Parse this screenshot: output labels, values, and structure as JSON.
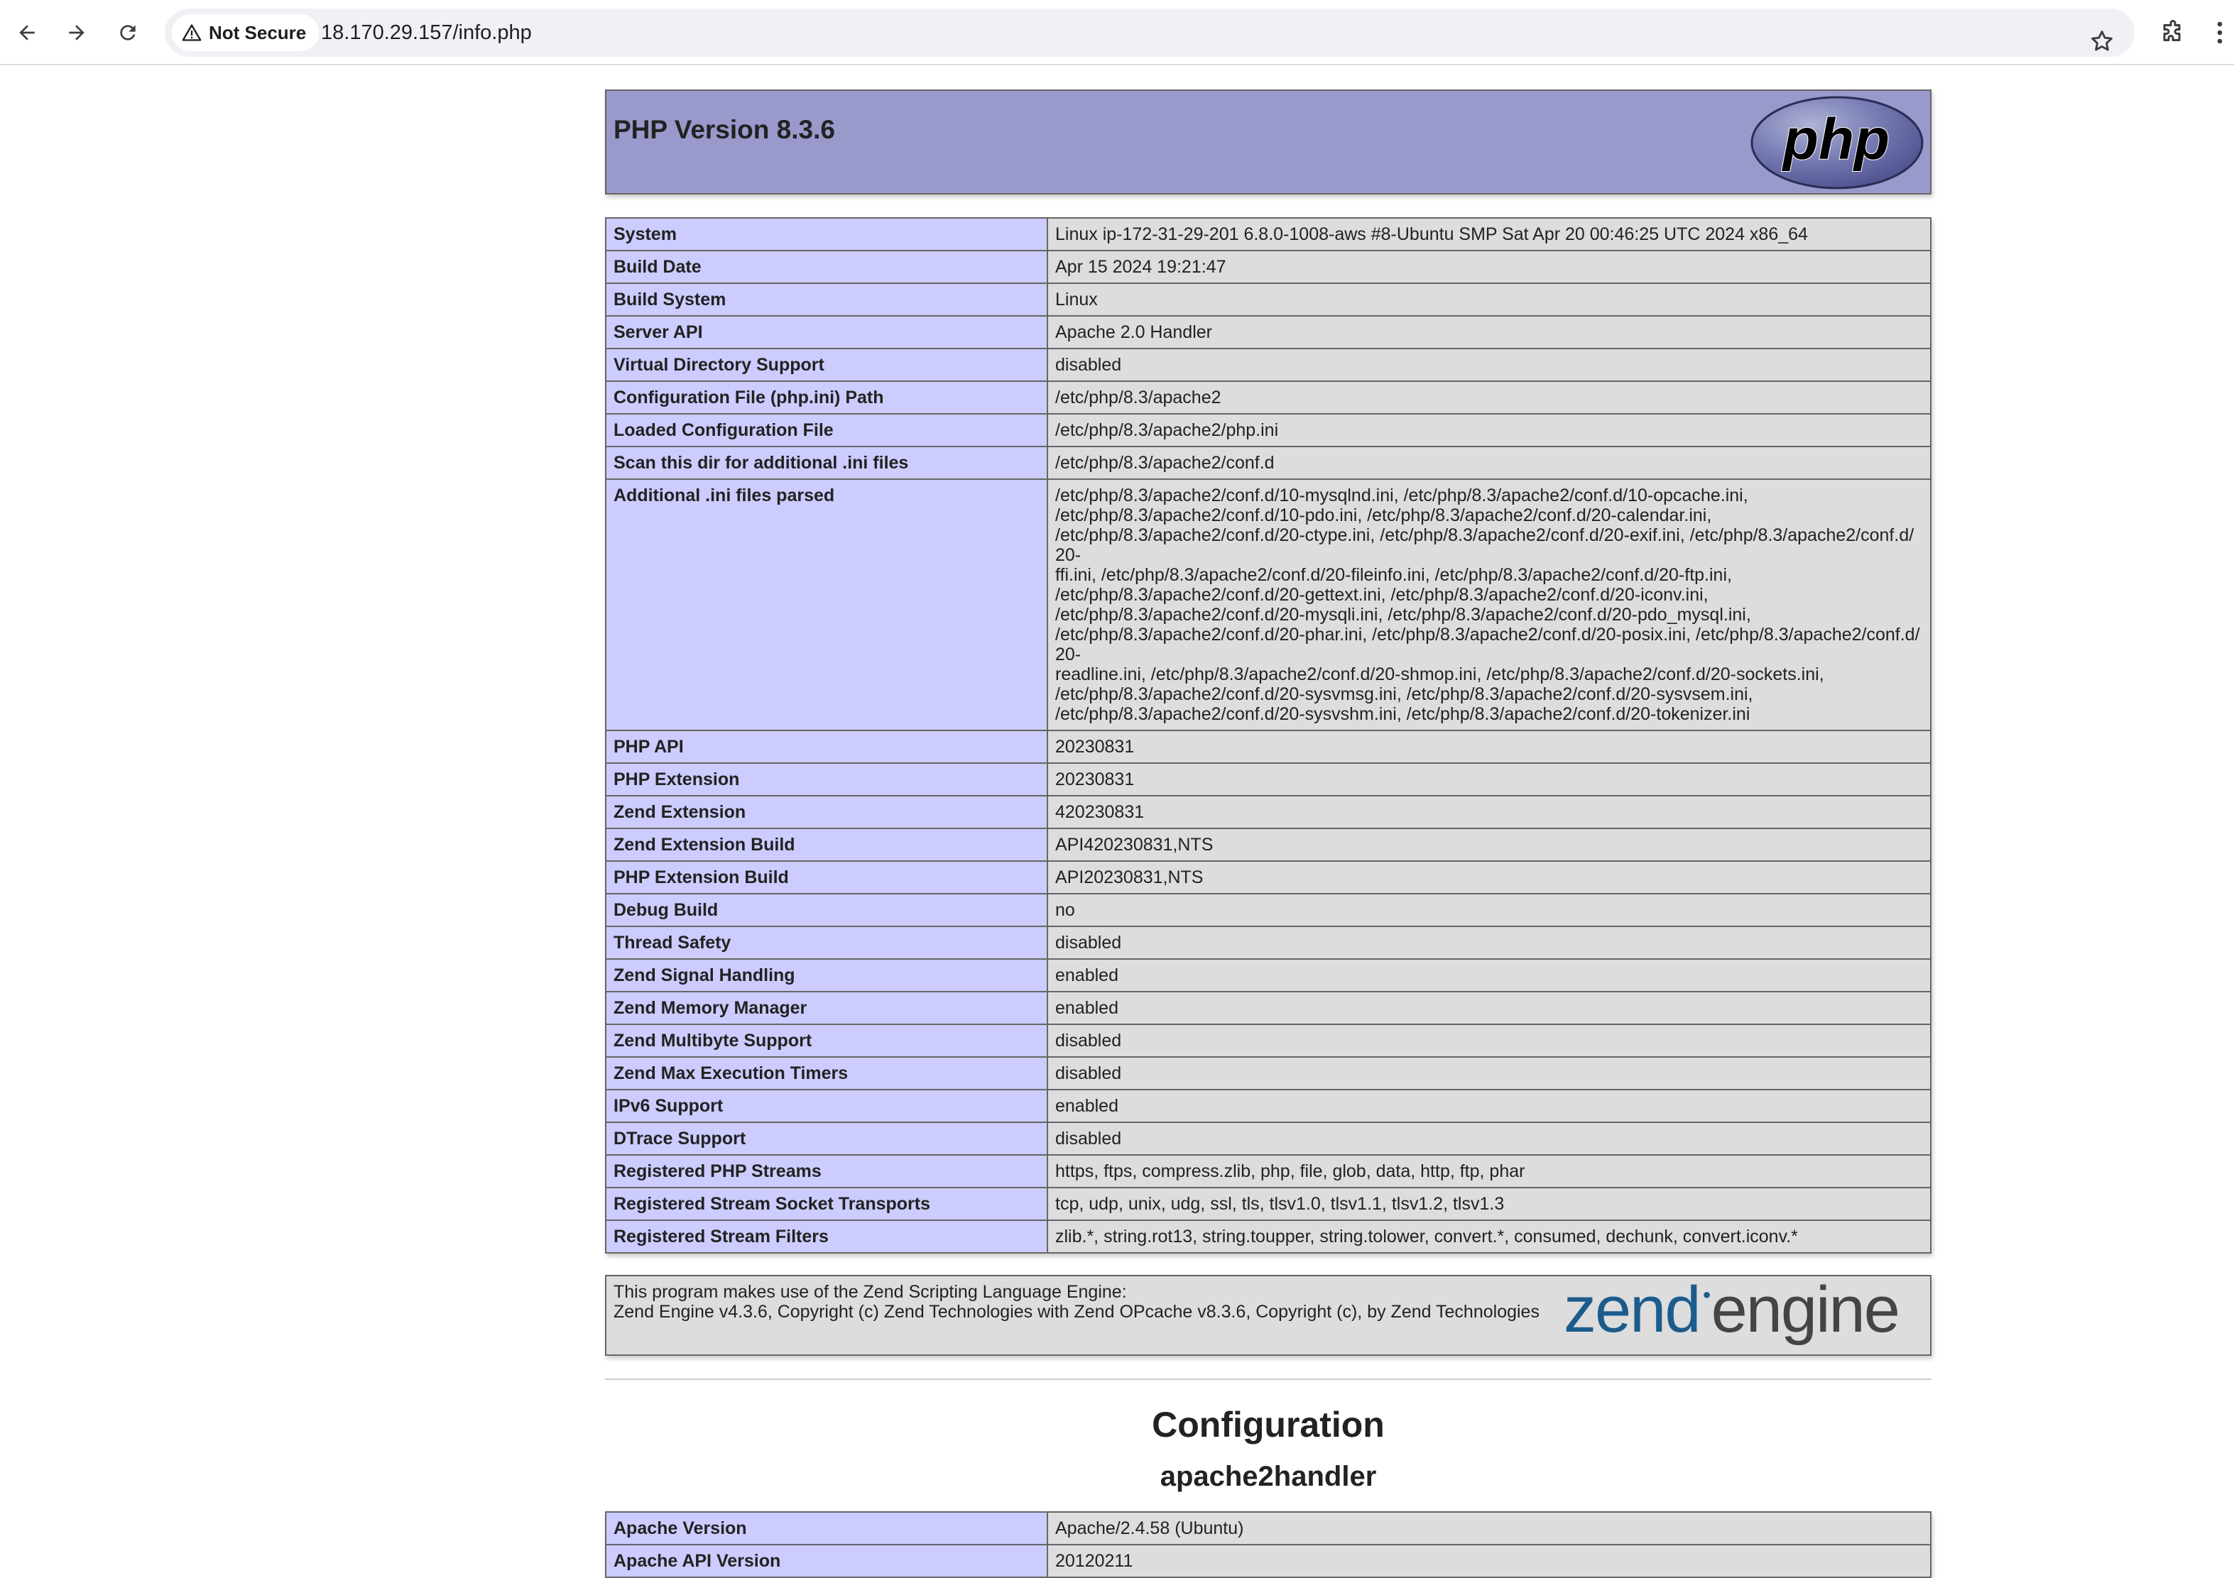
{
  "browser": {
    "security_label": "Not Secure",
    "url": "18.170.29.157/info.php"
  },
  "header": {
    "title": "PHP Version 8.3.6",
    "logo_text": "php"
  },
  "info_rows": [
    {
      "key": "System",
      "value": "Linux ip-172-31-29-201 6.8.0-1008-aws #8-Ubuntu SMP Sat Apr 20 00:46:25 UTC 2024 x86_64"
    },
    {
      "key": "Build Date",
      "value": "Apr 15 2024 19:21:47"
    },
    {
      "key": "Build System",
      "value": "Linux"
    },
    {
      "key": "Server API",
      "value": "Apache 2.0 Handler"
    },
    {
      "key": "Virtual Directory Support",
      "value": "disabled"
    },
    {
      "key": "Configuration File (php.ini) Path",
      "value": "/etc/php/8.3/apache2"
    },
    {
      "key": "Loaded Configuration File",
      "value": "/etc/php/8.3/apache2/php.ini"
    },
    {
      "key": "Scan this dir for additional .ini files",
      "value": "/etc/php/8.3/apache2/conf.d"
    },
    {
      "key": "Additional .ini files parsed",
      "value_lines": [
        "/etc/php/8.3/apache2/conf.d/10-mysqlnd.ini, /etc/php/8.3/apache2/conf.d/10-opcache.ini,",
        "/etc/php/8.3/apache2/conf.d/10-pdo.ini, /etc/php/8.3/apache2/conf.d/20-calendar.ini,",
        "/etc/php/8.3/apache2/conf.d/20-ctype.ini, /etc/php/8.3/apache2/conf.d/20-exif.ini, /etc/php/8.3/apache2/conf.d/20-",
        "ffi.ini, /etc/php/8.3/apache2/conf.d/20-fileinfo.ini, /etc/php/8.3/apache2/conf.d/20-ftp.ini,",
        "/etc/php/8.3/apache2/conf.d/20-gettext.ini, /etc/php/8.3/apache2/conf.d/20-iconv.ini,",
        "/etc/php/8.3/apache2/conf.d/20-mysqli.ini, /etc/php/8.3/apache2/conf.d/20-pdo_mysql.ini,",
        "/etc/php/8.3/apache2/conf.d/20-phar.ini, /etc/php/8.3/apache2/conf.d/20-posix.ini, /etc/php/8.3/apache2/conf.d/20-",
        "readline.ini, /etc/php/8.3/apache2/conf.d/20-shmop.ini, /etc/php/8.3/apache2/conf.d/20-sockets.ini,",
        "/etc/php/8.3/apache2/conf.d/20-sysvmsg.ini, /etc/php/8.3/apache2/conf.d/20-sysvsem.ini,",
        "/etc/php/8.3/apache2/conf.d/20-sysvshm.ini, /etc/php/8.3/apache2/conf.d/20-tokenizer.ini"
      ]
    },
    {
      "key": "PHP API",
      "value": "20230831"
    },
    {
      "key": "PHP Extension",
      "value": "20230831"
    },
    {
      "key": "Zend Extension",
      "value": "420230831"
    },
    {
      "key": "Zend Extension Build",
      "value": "API420230831,NTS"
    },
    {
      "key": "PHP Extension Build",
      "value": "API20230831,NTS"
    },
    {
      "key": "Debug Build",
      "value": "no"
    },
    {
      "key": "Thread Safety",
      "value": "disabled"
    },
    {
      "key": "Zend Signal Handling",
      "value": "enabled"
    },
    {
      "key": "Zend Memory Manager",
      "value": "enabled"
    },
    {
      "key": "Zend Multibyte Support",
      "value": "disabled"
    },
    {
      "key": "Zend Max Execution Timers",
      "value": "disabled"
    },
    {
      "key": "IPv6 Support",
      "value": "enabled"
    },
    {
      "key": "DTrace Support",
      "value": "disabled"
    },
    {
      "key": "Registered PHP Streams",
      "value": "https, ftps, compress.zlib, php, file, glob, data, http, ftp, phar"
    },
    {
      "key": "Registered Stream Socket Transports",
      "value": "tcp, udp, unix, udg, ssl, tls, tlsv1.0, tlsv1.1, tlsv1.2, tlsv1.3"
    },
    {
      "key": "Registered Stream Filters",
      "value": "zlib.*, string.rot13, string.toupper, string.tolower, convert.*, consumed, dechunk, convert.iconv.*"
    }
  ],
  "zend": {
    "line1": "This program makes use of the Zend Scripting Language Engine:",
    "line2": "Zend Engine v4.3.6, Copyright (c) Zend Technologies with Zend OPcache v8.3.6, Copyright (c), by Zend Technologies",
    "logo_word1": "zend",
    "logo_word2": "engine"
  },
  "configuration": {
    "title": "Configuration",
    "module": "apache2handler",
    "rows": [
      {
        "key": "Apache Version",
        "value": "Apache/2.4.58 (Ubuntu)"
      },
      {
        "key": "Apache API Version",
        "value": "20120211"
      }
    ]
  },
  "colors": {
    "header_bg": "#9999cc",
    "key_bg": "#ccccff",
    "value_bg": "#dddddd",
    "border": "#666666"
  }
}
